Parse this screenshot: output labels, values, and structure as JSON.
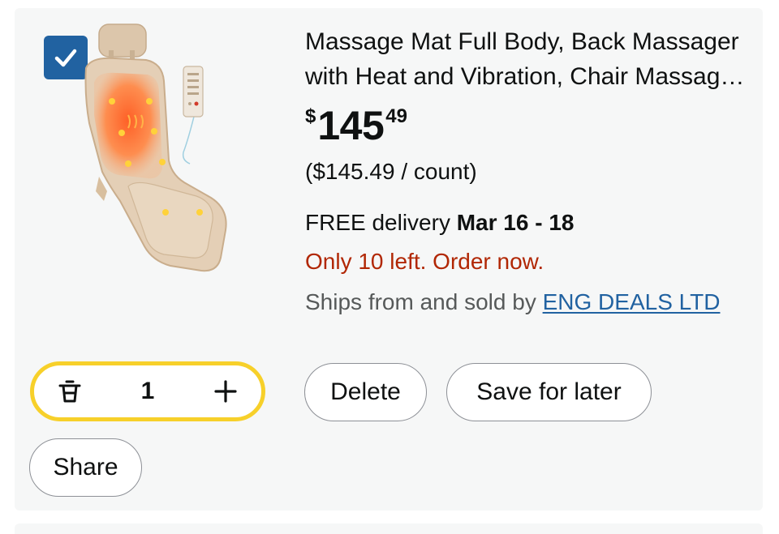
{
  "item": {
    "title": "Massage Mat Full Body, Back Massager with Heat and Vibration, Chair Massage Pad for Home and Office",
    "price": {
      "symbol": "$",
      "whole": "145",
      "fraction": "49"
    },
    "unit_price": "($145.49 / count)",
    "delivery": {
      "prefix": "FREE delivery ",
      "dates": "Mar 16 - 18"
    },
    "stock": "Only 10 left. Order now.",
    "ships": {
      "text": "Ships from and sold by ",
      "seller": "ENG DEALS LTD"
    },
    "selected": true,
    "image_icon": "massage-mat-image"
  },
  "quantity": {
    "value": "1",
    "decrease_icon": "trash-icon",
    "increase_icon": "plus-icon"
  },
  "actions": {
    "delete": "Delete",
    "save_for_later": "Save for later",
    "share": "Share"
  },
  "colors": {
    "checkbox": "#2162a1",
    "stepper_border": "#f7d02a",
    "stock": "#b12704",
    "link": "#2162a1",
    "card_bg": "#f6f7f7"
  }
}
